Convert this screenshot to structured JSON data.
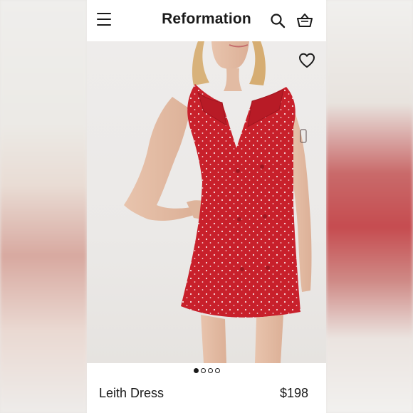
{
  "header": {
    "brand": "Reformation",
    "icons": [
      "menu-icon",
      "search-icon",
      "cart-icon"
    ]
  },
  "hero": {
    "image_description_icon": "product-photo",
    "favorite_icon": "heart-icon",
    "carousel": {
      "total": 4,
      "active_index": 0
    }
  },
  "product": {
    "name": "Leith Dress",
    "price": "$198"
  },
  "colors": {
    "dress": "#c8202b",
    "background": "#eeeceb",
    "text": "#1a1a1a"
  }
}
